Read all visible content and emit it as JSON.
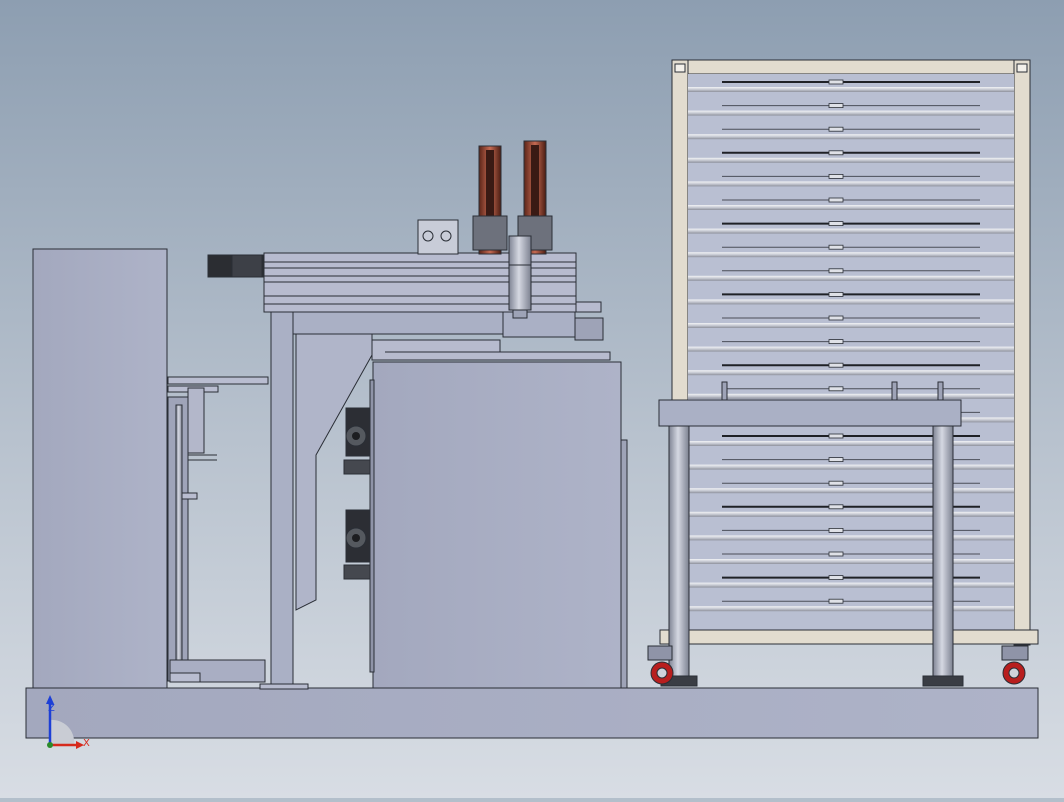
{
  "triad": {
    "z_label": "Z",
    "x_label": "X"
  },
  "colors": {
    "part_fill": "#a9aec3",
    "part_dark": "#8f94a8",
    "edge": "#2a2e36",
    "rack_frame": "#e2dccf",
    "rack_rod": "#d8dbe3",
    "cylinder_red": "#8a3a2a",
    "wheel_red": "#b81e1e",
    "axis_z": "#1d3fd6",
    "axis_x": "#d62a1d"
  }
}
